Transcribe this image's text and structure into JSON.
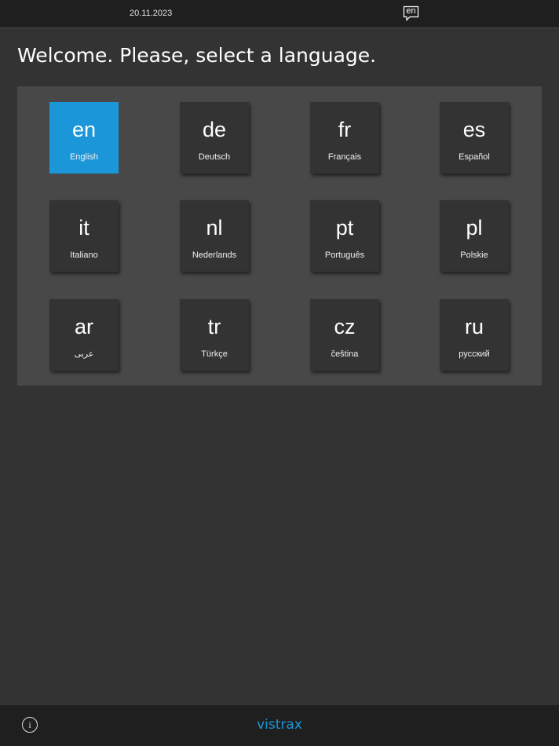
{
  "header": {
    "date": "20.11.2023",
    "current_language": "en"
  },
  "title": "Welcome. Please, select a language.",
  "languages": [
    {
      "code": "en",
      "name": "English",
      "selected": true
    },
    {
      "code": "de",
      "name": "Deutsch",
      "selected": false
    },
    {
      "code": "fr",
      "name": "Français",
      "selected": false
    },
    {
      "code": "es",
      "name": "Español",
      "selected": false
    },
    {
      "code": "it",
      "name": "Italiano",
      "selected": false
    },
    {
      "code": "nl",
      "name": "Nederlands",
      "selected": false
    },
    {
      "code": "pt",
      "name": "Português",
      "selected": false
    },
    {
      "code": "pl",
      "name": "Polskie",
      "selected": false
    },
    {
      "code": "ar",
      "name": "عربى",
      "selected": false
    },
    {
      "code": "tr",
      "name": "Türkçe",
      "selected": false
    },
    {
      "code": "cz",
      "name": "čeština",
      "selected": false
    },
    {
      "code": "ru",
      "name": "русский",
      "selected": false
    }
  ],
  "footer": {
    "info_icon": "info-icon",
    "info_glyph": "i",
    "brand": "vistrax"
  },
  "colors": {
    "accent": "#1b96d9",
    "background": "#333333",
    "panel": "#484848",
    "bar": "#1f1f1f"
  }
}
